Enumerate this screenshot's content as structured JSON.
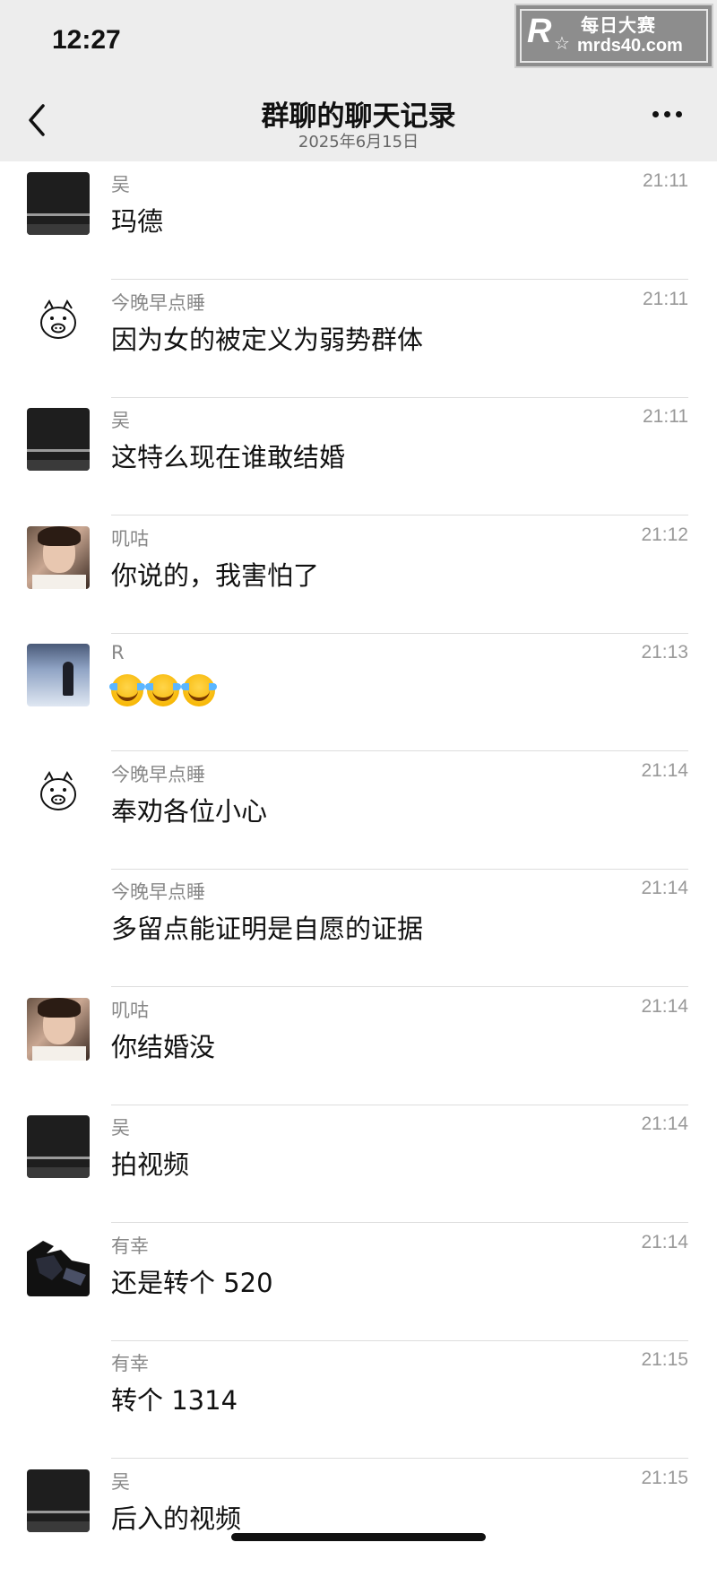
{
  "status_bar": {
    "time": "12:27"
  },
  "watermark": {
    "logo": "R",
    "text_cn": "每日大赛",
    "url": "mrds40.com"
  },
  "nav": {
    "title": "群聊的聊天记录",
    "subtitle": "2025年6月15日"
  },
  "messages": [
    {
      "avatar": "dark-screen-avatar",
      "sender": "吴",
      "time": "21:11",
      "text": "玛德"
    },
    {
      "avatar": "pig-face-avatar",
      "sender": "今晚早点睡",
      "time": "21:11",
      "text": "因为女的被定义为弱势群体"
    },
    {
      "avatar": "dark-screen-avatar",
      "sender": "吴",
      "time": "21:11",
      "text": "这特么现在谁敢结婚"
    },
    {
      "avatar": "portrait-avatar",
      "sender": "叽咕",
      "time": "21:12",
      "text": "你说的，我害怕了"
    },
    {
      "avatar": "snow-scene-avatar",
      "sender": "R",
      "time": "21:13",
      "text": "",
      "emojis": [
        "crying-laughing-emoji",
        "crying-laughing-emoji",
        "crying-laughing-emoji"
      ]
    },
    {
      "avatar": "pig-face-avatar",
      "sender": "今晚早点睡",
      "time": "21:14",
      "text": "奉劝各位小心"
    },
    {
      "avatar": "",
      "sender": "今晚早点睡",
      "time": "21:14",
      "text": "多留点能证明是自愿的证据"
    },
    {
      "avatar": "portrait-avatar",
      "sender": "叽咕",
      "time": "21:14",
      "text": "你结婚没"
    },
    {
      "avatar": "dark-screen-avatar",
      "sender": "吴",
      "time": "21:14",
      "text": "拍视频"
    },
    {
      "avatar": "anime-figure-avatar",
      "sender": "有幸",
      "time": "21:14",
      "text": "还是转个 520"
    },
    {
      "avatar": "",
      "sender": "有幸",
      "time": "21:15",
      "text": "转个 1314"
    },
    {
      "avatar": "dark-screen-avatar",
      "sender": "吴",
      "time": "21:15",
      "text": "后入的视频"
    }
  ]
}
